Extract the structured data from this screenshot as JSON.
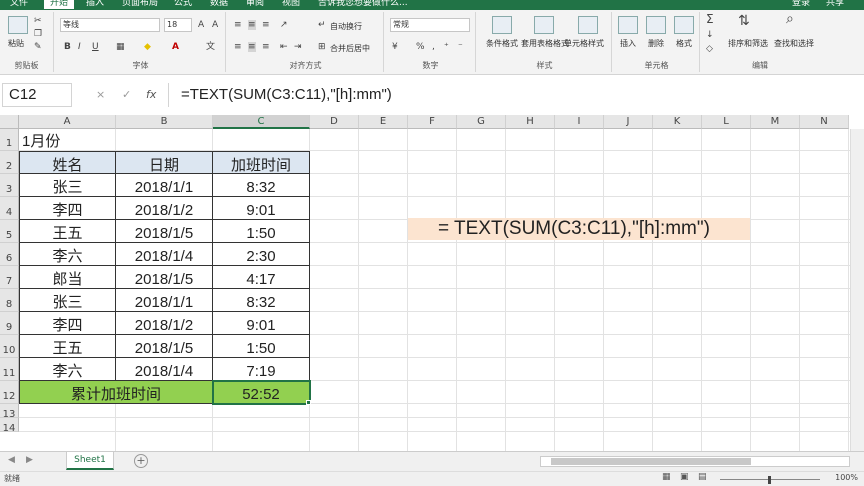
{
  "tabs": {
    "file": "文件",
    "home": "开始",
    "insert": "插入",
    "page_layout": "页面布局",
    "formulas": "公式",
    "data": "数据",
    "review": "审阅",
    "view": "视图",
    "tell_me": "告诉我您想要做什么...",
    "login": "登录",
    "share": "共享"
  },
  "ribbon": {
    "clipboard": {
      "paste": "粘贴",
      "label": "剪贴板"
    },
    "font": {
      "name": "等线",
      "size": "18",
      "bold": "B",
      "italic": "I",
      "underline": "U",
      "label": "字体"
    },
    "alignment": {
      "wrap": "自动换行",
      "merge": "合并后居中",
      "label": "对齐方式"
    },
    "number": {
      "format": "常规",
      "percent": "%",
      "comma": ",",
      "label": "数字"
    },
    "styles": {
      "conditional": "条件格式",
      "table": "套用表格格式",
      "cell": "单元格样式",
      "label": "样式"
    },
    "cells": {
      "insert": "插入",
      "delete": "删除",
      "format": "格式",
      "label": "单元格"
    },
    "editing": {
      "sort": "排序和筛选",
      "find": "查找和选择",
      "label": "编辑"
    }
  },
  "formula_bar": {
    "name_box": "C12",
    "cancel": "×",
    "enter": "✓",
    "fx": "fx",
    "formula": "=TEXT(SUM(C3:C11),\"[h]:mm\")"
  },
  "columns": [
    "A",
    "B",
    "C",
    "D",
    "E",
    "F",
    "G",
    "H",
    "I",
    "J",
    "K",
    "L",
    "M",
    "N"
  ],
  "rows": [
    "1",
    "2",
    "3",
    "4",
    "5",
    "6",
    "7",
    "8",
    "9",
    "10",
    "11",
    "12",
    "13",
    "14"
  ],
  "sheet": {
    "a1": "1月份",
    "headers": [
      "姓名",
      "日期",
      "加班时间"
    ],
    "records": [
      [
        "张三",
        "2018/1/1",
        "8:32"
      ],
      [
        "李四",
        "2018/1/2",
        "9:01"
      ],
      [
        "王五",
        "2018/1/5",
        "1:50"
      ],
      [
        "李六",
        "2018/1/4",
        "2:30"
      ],
      [
        "郎当",
        "2018/1/5",
        "4:17"
      ],
      [
        "张三",
        "2018/1/1",
        "8:32"
      ],
      [
        "李四",
        "2018/1/2",
        "9:01"
      ],
      [
        "王五",
        "2018/1/5",
        "1:50"
      ],
      [
        "李六",
        "2018/1/4",
        "7:19"
      ]
    ],
    "total_label": "累计加班时间",
    "total_value": "52:52",
    "callout": "= TEXT(SUM(C3:C11),\"[h]:mm\")"
  },
  "sheet_tabs": {
    "sheet1": "Sheet1",
    "add": "+"
  },
  "status": {
    "ready": "就绪",
    "zoom": "100%"
  },
  "colors": {
    "accent": "#217346",
    "header_fill": "#dce6f1",
    "total_fill": "#92d050",
    "callout_fill": "#fce4d0"
  }
}
